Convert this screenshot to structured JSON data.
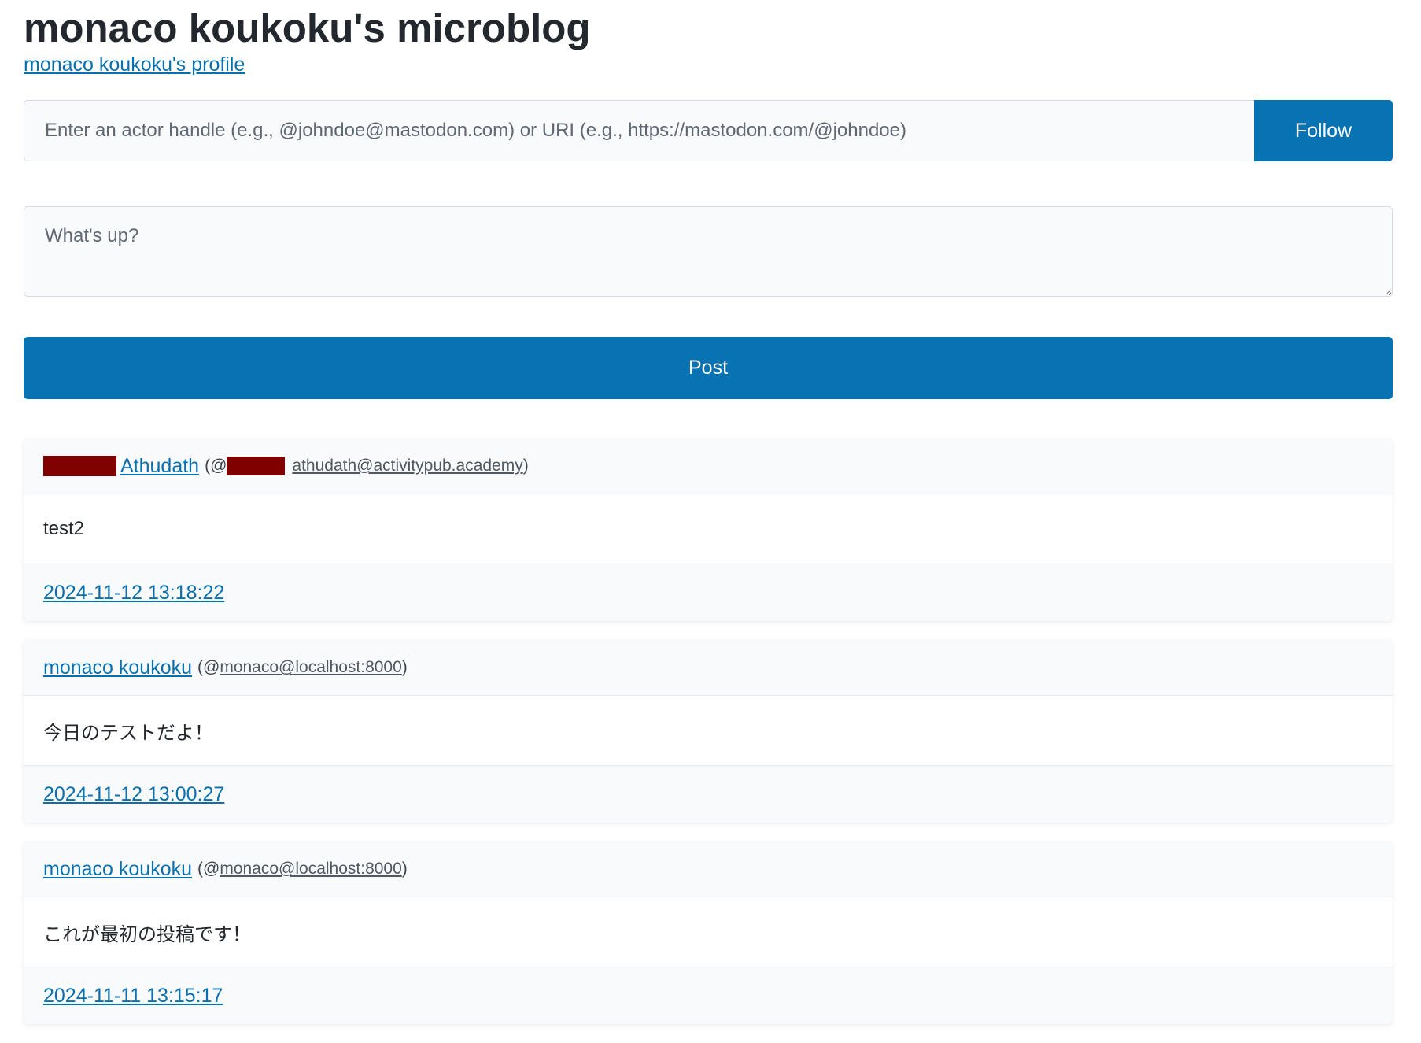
{
  "header": {
    "title": "monaco koukoku's microblog",
    "profile_link": "monaco koukoku's profile"
  },
  "follow_form": {
    "placeholder": "Enter an actor handle (e.g., @johndoe@mastodon.com) or URI (e.g., https://mastodon.com/@johndoe)",
    "button_label": "Follow"
  },
  "compose": {
    "placeholder": "What's up?",
    "button_label": "Post"
  },
  "colors": {
    "accent": "#0873b2",
    "link": "#0870b0",
    "redaction": "#800000"
  },
  "posts": [
    {
      "author_name": "Athudath",
      "handle_prefix": "(@",
      "handle": "athudath@activitypub.academy",
      "handle_suffix": ")",
      "content": "test2",
      "timestamp": "2024-11-12 13:18:22"
    },
    {
      "author_name": "monaco koukoku",
      "handle_prefix": "(@",
      "handle": "monaco@localhost:8000",
      "handle_suffix": ")",
      "content": "今日のテストだよ！",
      "timestamp": "2024-11-12 13:00:27"
    },
    {
      "author_name": "monaco koukoku",
      "handle_prefix": "(@",
      "handle": "monaco@localhost:8000",
      "handle_suffix": ")",
      "content": "これが最初の投稿です！",
      "timestamp": "2024-11-11 13:15:17"
    }
  ]
}
